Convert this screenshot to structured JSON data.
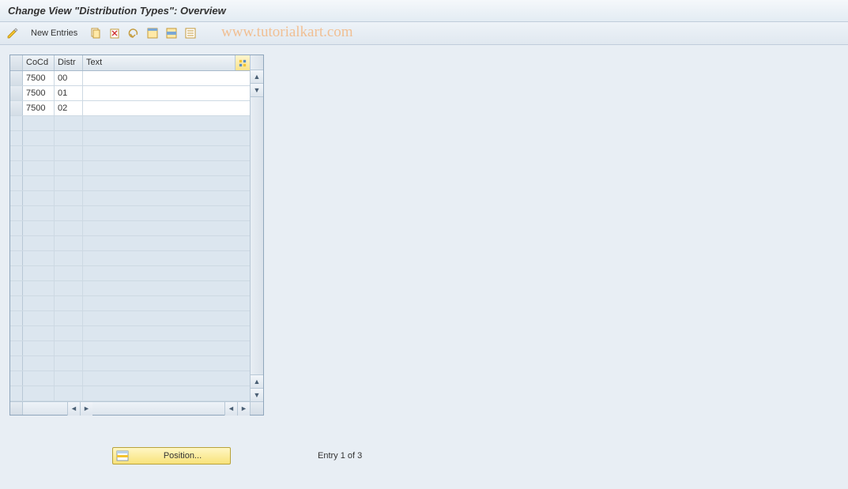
{
  "title": "Change View \"Distribution Types\": Overview",
  "watermark": "www.tutorialkart.com",
  "toolbar": {
    "new_entries": "New Entries"
  },
  "table": {
    "headers": {
      "cocd": "CoCd",
      "distr": "Distr",
      "text": "Text"
    },
    "rows": [
      {
        "cocd": "7500",
        "distr": "00",
        "text": ""
      },
      {
        "cocd": "7500",
        "distr": "01",
        "text": ""
      },
      {
        "cocd": "7500",
        "distr": "02",
        "text": ""
      }
    ],
    "empty_rows": 19
  },
  "footer": {
    "position_label": "Position...",
    "entry_text": "Entry 1 of 3"
  }
}
